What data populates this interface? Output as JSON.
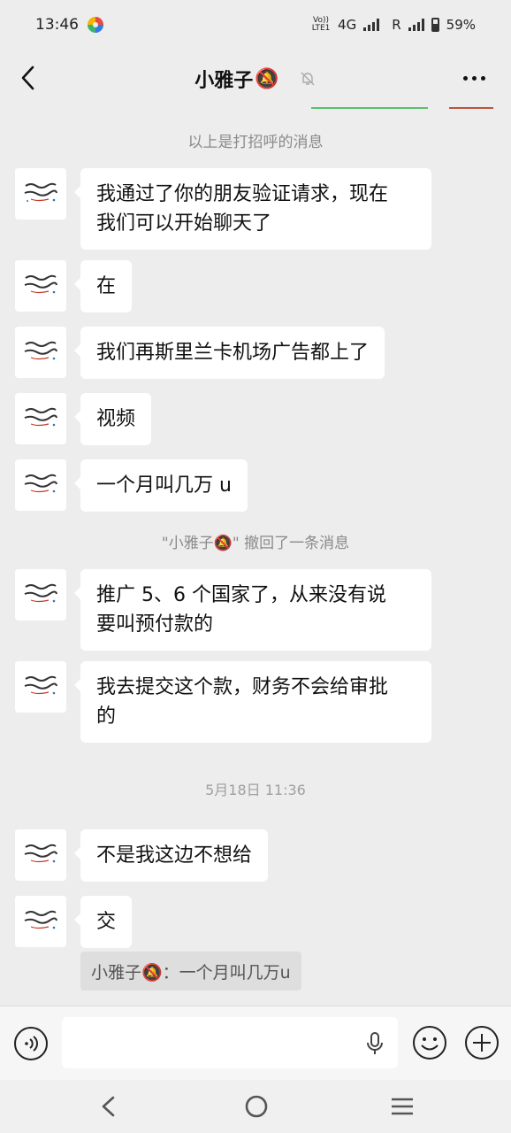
{
  "status_bar": {
    "time": "13:46",
    "volte": "Vo)) LTE1",
    "network": "4G",
    "roaming": "R",
    "battery": "59%"
  },
  "header": {
    "title": "小雅子",
    "title_emoji": "🔕"
  },
  "system_messages": {
    "greeting_divider": "以上是打招呼的消息",
    "recall_notice": "\"小雅子🔕\" 撤回了一条消息",
    "timestamp": "5月18日 11:36"
  },
  "messages": [
    {
      "line1": "我通过了你的朋友验证请求，现在",
      "line2": "我们可以开始聊天了"
    },
    {
      "line1": "在"
    },
    {
      "line1": "我们再斯里兰卡机场广告都上了"
    },
    {
      "line1": "视频"
    },
    {
      "line1": "一个月叫几万 u"
    },
    {
      "line1": "推广 5、6 个国家了，从来没有说",
      "line2": "要叫预付款的"
    },
    {
      "line1": "我去提交这个款，财务不会给审批",
      "line2": "的"
    },
    {
      "line1": "不是我这边不想给"
    },
    {
      "line1": "交"
    }
  ],
  "quote": {
    "text": "小雅子🔕：一个月叫几万u"
  },
  "input": {
    "placeholder": ""
  },
  "icons": {
    "back": "chevron-left-icon",
    "mute": "bell-off-icon",
    "more": "more-dots-icon",
    "voice": "voice-icon",
    "mic": "mic-icon",
    "emoji": "emoji-icon",
    "plus": "plus-icon"
  },
  "colors": {
    "background": "#ededed",
    "bubble": "#ffffff",
    "system_text": "#8a8a8a"
  }
}
